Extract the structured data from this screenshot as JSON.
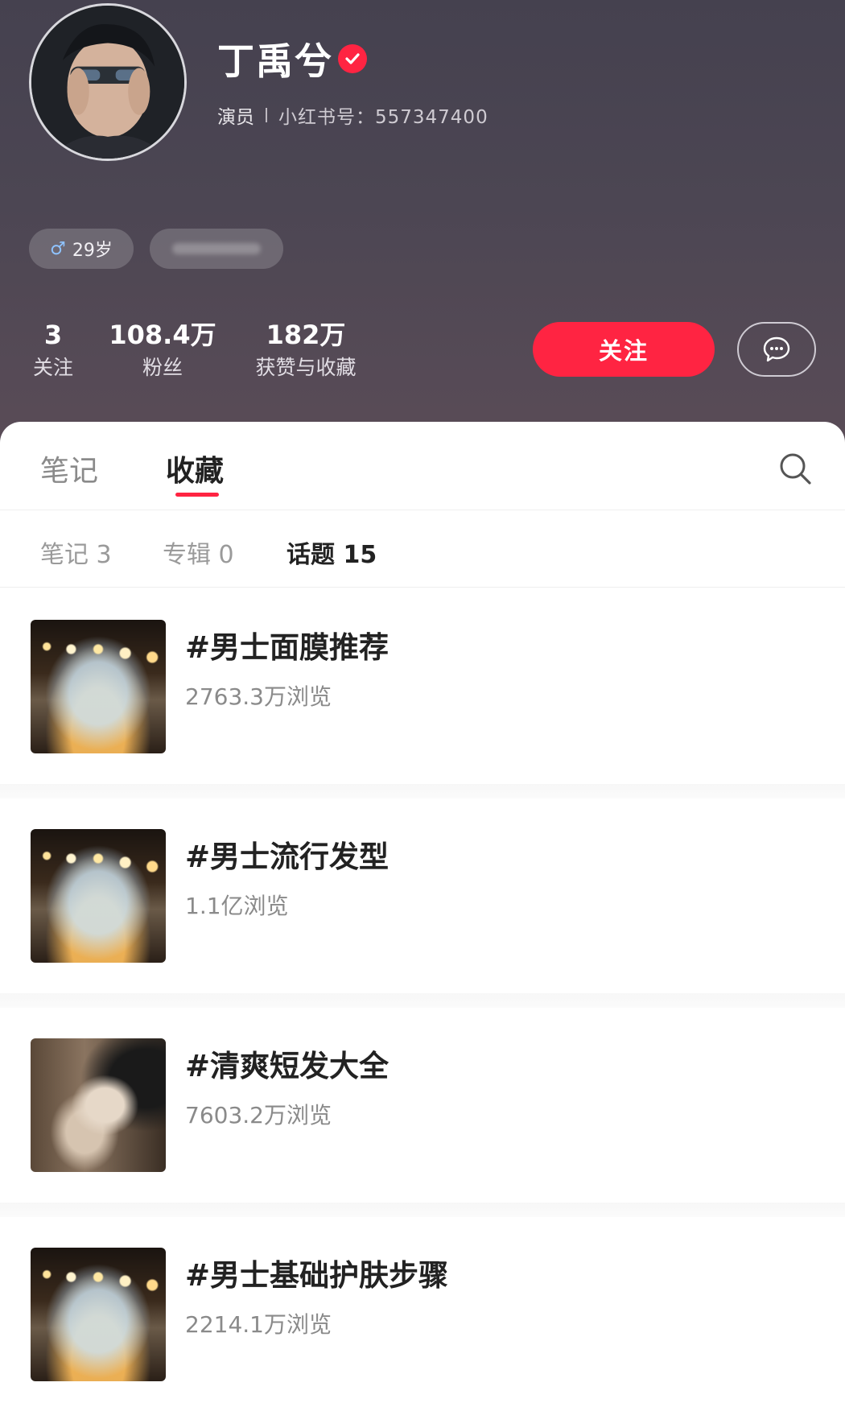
{
  "profile": {
    "name": "丁禹兮",
    "role": "演员",
    "id_label": "小红书号：",
    "id_value": "557347400",
    "age_chip": "29岁",
    "gender_symbol": "♂"
  },
  "stats": [
    {
      "value": "3",
      "label": "关注"
    },
    {
      "value": "108.4万",
      "label": "粉丝"
    },
    {
      "value": "182万",
      "label": "获赞与收藏"
    }
  ],
  "actions": {
    "follow_label": "关注"
  },
  "tabs": [
    {
      "label": "笔记",
      "active": false
    },
    {
      "label": "收藏",
      "active": true
    }
  ],
  "subtabs": [
    {
      "label": "笔记 3",
      "active": false
    },
    {
      "label": "专辑 0",
      "active": false
    },
    {
      "label": "话题 15",
      "active": true
    }
  ],
  "topics": [
    {
      "title": "#男士面膜推荐",
      "views": "2763.3万浏览"
    },
    {
      "title": "#男士流行发型",
      "views": "1.1亿浏览"
    },
    {
      "title": "#清爽短发大全",
      "views": "7603.2万浏览"
    },
    {
      "title": "#男士基础护肤步骤",
      "views": "2214.1万浏览"
    }
  ],
  "colors": {
    "accent": "#ff2442",
    "header_bg": "#4a4552"
  }
}
